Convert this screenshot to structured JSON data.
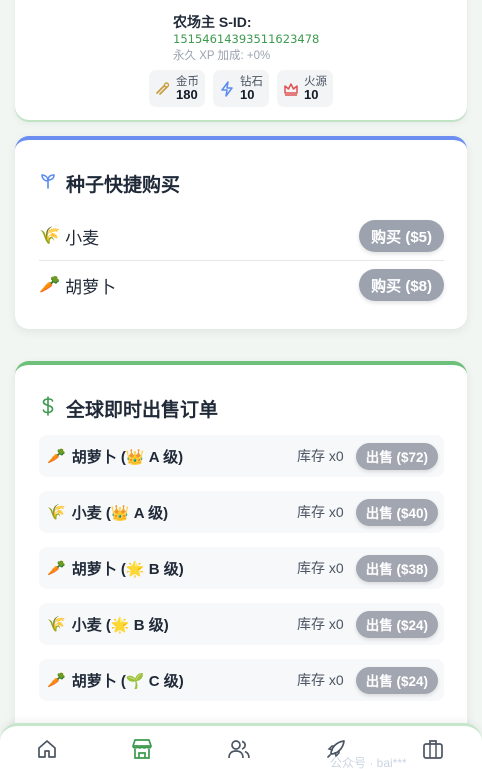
{
  "profile": {
    "title": "农场主 S-ID:",
    "id": "1515461439351162347​8",
    "xp": "永久 XP 加成: +0%",
    "stats": [
      {
        "label": "金币",
        "value": "180",
        "icon": "coins-icon",
        "color": "#c8a040"
      },
      {
        "label": "钻石",
        "value": "10",
        "icon": "lightning-icon",
        "color": "#5b8def"
      },
      {
        "label": "火源",
        "value": "10",
        "icon": "crown-icon",
        "color": "#e05252"
      }
    ]
  },
  "seed_shop": {
    "title": "种子快捷购买",
    "title_icon": "sprout-icon",
    "items": [
      {
        "emoji": "🌾",
        "name": "小麦",
        "button": "购买 ($5)"
      },
      {
        "emoji": "🥕",
        "name": "胡萝卜",
        "button": "购买 ($8)"
      }
    ]
  },
  "orders": {
    "title": "全球即时出售订单",
    "title_icon": "dollar-icon",
    "rows": [
      {
        "emoji": "🥕",
        "name": "胡萝卜 (",
        "grade_emoji": "👑",
        "grade": " A 级)",
        "stock": "库存 x0",
        "button": "出售 ($72)"
      },
      {
        "emoji": "🌾",
        "name": "小麦 (",
        "grade_emoji": "👑",
        "grade": " A 级)",
        "stock": "库存 x0",
        "button": "出售 ($40)"
      },
      {
        "emoji": "🥕",
        "name": "胡萝卜 (",
        "grade_emoji": "🌟",
        "grade": " B 级)",
        "stock": "库存 x0",
        "button": "出售 ($38)"
      },
      {
        "emoji": "🌾",
        "name": "小麦 (",
        "grade_emoji": "🌟",
        "grade": " B 级)",
        "stock": "库存 x0",
        "button": "出售 ($24)"
      },
      {
        "emoji": "🥕",
        "name": "胡萝卜 (",
        "grade_emoji": "🌱",
        "grade": " C 级)",
        "stock": "库存 x0",
        "button": "出售 ($24)"
      }
    ]
  },
  "nav": {
    "items": [
      {
        "label": "农场",
        "icon": "home-icon"
      },
      {
        "label": "市场",
        "icon": "store-icon",
        "active": true
      },
      {
        "label": "社交",
        "icon": "users-icon"
      },
      {
        "label": "火箭",
        "icon": "rocket-icon"
      },
      {
        "label": "背包",
        "icon": "bag-icon"
      }
    ],
    "watermark": "公众号 · bai***"
  },
  "colors": {
    "accent_green": "#3d9a4f",
    "seed_card_border": "#6b8ef0",
    "orders_card_border": "#6cc079",
    "button_gray": "#9ca3af"
  }
}
